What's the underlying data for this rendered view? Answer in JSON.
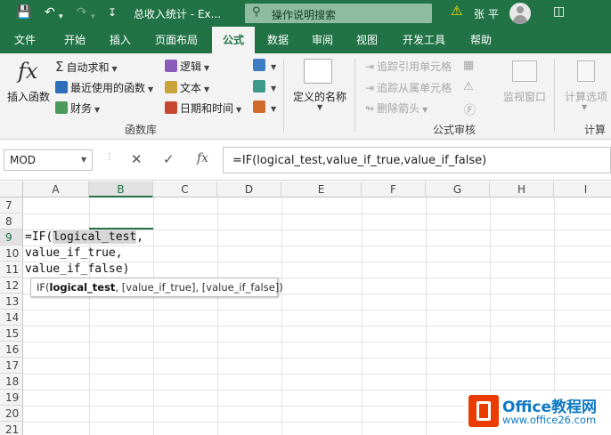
{
  "titlebar": {
    "doc_title": "总收入统计 - Ex...",
    "search_placeholder": "操作说明搜索",
    "user_name": "张 平",
    "save_icon": "save-icon",
    "undo_icon": "undo-icon",
    "redo_icon": "redo-icon"
  },
  "tabs": [
    "文件",
    "开始",
    "插入",
    "页面布局",
    "公式",
    "数据",
    "审阅",
    "视图",
    "开发工具",
    "帮助"
  ],
  "active_tab": "公式",
  "ribbon": {
    "insert_function": "插入函数",
    "autosum": "自动求和",
    "recent": "最近使用的函数",
    "financial": "财务",
    "logical": "逻辑",
    "text": "文本",
    "datetime": "日期和时间",
    "library_label": "函数库",
    "defined_names": "定义的名称",
    "trace_precedents": "追踪引用单元格",
    "trace_dependents": "追踪从属单元格",
    "remove_arrows": "删除箭头",
    "auditing_label": "公式审核",
    "watch_window": "监视窗口",
    "calc_options": "计算选项",
    "calc_label": "计算"
  },
  "formula_bar": {
    "name_box": "MOD",
    "formula": "=IF(logical_test,value_if_true,value_if_false)"
  },
  "grid": {
    "columns": [
      "A",
      "B",
      "C",
      "D",
      "E",
      "F",
      "G",
      "H",
      "I"
    ],
    "rows": [
      "7",
      "8",
      "9",
      "10",
      "11",
      "12",
      "13",
      "14",
      "15",
      "16",
      "17",
      "18",
      "19",
      "20",
      "21"
    ],
    "cell_lines": {
      "l1_prefix": "=IF(",
      "l1_arg": "logical_test",
      "l1_suffix": ",",
      "l2": "value_if_true,",
      "l3": "value_if_false)"
    },
    "tooltip": {
      "fn": "IF(",
      "arg1": "logical_test",
      "rest": ", [value_if_true], [value_if_false])"
    }
  },
  "watermark": {
    "name": "Office教程网",
    "url": "www.office26.com"
  },
  "colors": {
    "brand_green": "#217346",
    "accent_orange": "#eb3c00",
    "watermark_blue": "#0e7ac4"
  }
}
